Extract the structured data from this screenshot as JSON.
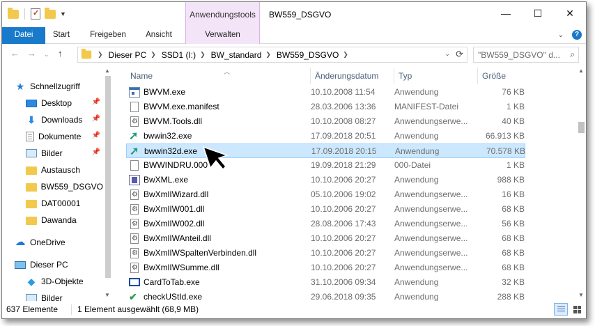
{
  "window": {
    "title": "BW559_DSGVO",
    "context_tab_group": "Anwendungstools",
    "controls": [
      "—",
      "☐",
      "✕"
    ]
  },
  "ribbon": {
    "tabs": [
      "Datei",
      "Start",
      "Freigeben",
      "Ansicht",
      "Verwalten"
    ]
  },
  "address": {
    "crumbs": [
      "Dieser PC",
      "SSD1 (I:)",
      "BW_standard",
      "BW559_DSGVO"
    ],
    "search_placeholder": "\"BW559_DSGVO\" d..."
  },
  "nav": {
    "items": [
      {
        "label": "Schnellzugriff",
        "icon": "star-icon",
        "pinned": false
      },
      {
        "label": "Desktop",
        "icon": "desktop-icon",
        "pinned": true
      },
      {
        "label": "Downloads",
        "icon": "download-icon",
        "pinned": true
      },
      {
        "label": "Dokumente",
        "icon": "document-icon",
        "pinned": true
      },
      {
        "label": "Bilder",
        "icon": "pictures-icon",
        "pinned": true
      },
      {
        "label": "Austausch",
        "icon": "folder-icon",
        "pinned": false
      },
      {
        "label": "BW559_DSGVO",
        "icon": "folder-icon",
        "pinned": false
      },
      {
        "label": "DAT00001",
        "icon": "folder-icon",
        "pinned": false
      },
      {
        "label": "Dawanda",
        "icon": "folder-icon",
        "pinned": false
      },
      {
        "label": "OneDrive",
        "icon": "cloud-icon",
        "pinned": false
      },
      {
        "label": "Dieser PC",
        "icon": "computer-icon",
        "pinned": false
      },
      {
        "label": "3D-Objekte",
        "icon": "3d-objects-icon",
        "pinned": false
      },
      {
        "label": "Bilder",
        "icon": "pictures-icon",
        "pinned": false
      }
    ]
  },
  "columns": {
    "name": "Name",
    "date": "Änderungsdatum",
    "type": "Typ",
    "size": "Größe"
  },
  "files": [
    {
      "name": "BWVM.exe",
      "date": "10.10.2008 11:54",
      "type": "Anwendung",
      "size": "76 KB",
      "icon": "application-icon"
    },
    {
      "name": "BWVM.exe.manifest",
      "date": "28.03.2006 13:36",
      "type": "MANIFEST-Datei",
      "size": "1 KB",
      "icon": "file-icon"
    },
    {
      "name": "BWVM.Tools.dll",
      "date": "10.10.2008 08:27",
      "type": "Anwendungserwe...",
      "size": "40 KB",
      "icon": "dll-icon"
    },
    {
      "name": "bwwin32.exe",
      "date": "17.09.2018 20:51",
      "type": "Anwendung",
      "size": "66.913 KB",
      "icon": "bw-arrow-icon"
    },
    {
      "name": "bwwin32d.exe",
      "date": "17.09.2018 20:15",
      "type": "Anwendung",
      "size": "70.578 KB",
      "icon": "bw-arrow-icon",
      "selected": true
    },
    {
      "name": "BWWINDRU.000",
      "date": "19.09.2018 21:29",
      "type": "000-Datei",
      "size": "1 KB",
      "icon": "file-icon"
    },
    {
      "name": "BwXML.exe",
      "date": "10.10.2006 20:27",
      "type": "Anwendung",
      "size": "988 KB",
      "icon": "xml-app-icon"
    },
    {
      "name": "BwXmlIWizard.dll",
      "date": "05.10.2006 19:02",
      "type": "Anwendungserwe...",
      "size": "16 KB",
      "icon": "dll-icon"
    },
    {
      "name": "BwXmlIW001.dll",
      "date": "10.10.2006 20:27",
      "type": "Anwendungserwe...",
      "size": "68 KB",
      "icon": "dll-icon"
    },
    {
      "name": "BwXmlIW002.dll",
      "date": "28.08.2006 17:43",
      "type": "Anwendungserwe...",
      "size": "56 KB",
      "icon": "dll-icon"
    },
    {
      "name": "BwXmlIWAnteil.dll",
      "date": "10.10.2006 20:27",
      "type": "Anwendungserwe...",
      "size": "68 KB",
      "icon": "dll-icon"
    },
    {
      "name": "BwXmlIWSpaltenVerbinden.dll",
      "date": "10.10.2006 20:27",
      "type": "Anwendungserwe...",
      "size": "68 KB",
      "icon": "dll-icon"
    },
    {
      "name": "BwXmlIWSumme.dll",
      "date": "10.10.2006 20:27",
      "type": "Anwendungserwe...",
      "size": "68 KB",
      "icon": "dll-icon"
    },
    {
      "name": "CardToTab.exe",
      "date": "31.10.2006 09:34",
      "type": "Anwendung",
      "size": "32 KB",
      "icon": "card-app-icon"
    },
    {
      "name": "checkUStId.exe",
      "date": "29.06.2018 09:35",
      "type": "Anwendung",
      "size": "288 KB",
      "icon": "check-app-icon"
    }
  ],
  "status": {
    "count": "637 Elemente",
    "selection": "1 Element ausgewählt (68,9 MB)"
  }
}
